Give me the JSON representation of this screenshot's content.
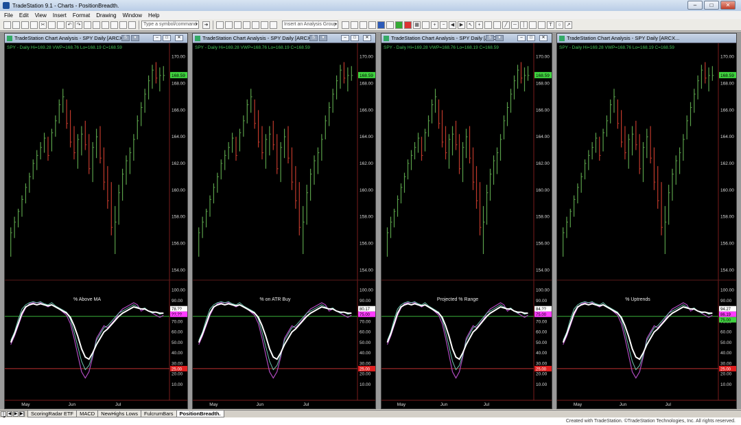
{
  "window": {
    "title": "TradeStation 9.1 - Charts - PositionBreadth."
  },
  "menu": [
    "File",
    "Edit",
    "View",
    "Insert",
    "Format",
    "Drawing",
    "Window",
    "Help"
  ],
  "toolbar": {
    "symbol_placeholder": "Type a symbol/command",
    "analysis_placeholder": "Insert an Analysis Group"
  },
  "charts": [
    {
      "title": "TradeStation Chart Analysis - SPY Daily [ARCX...",
      "quote": "SPY - Daily  Hi=169.28  VWP=168.76  Lo=168.19  C=168.59",
      "indicator": "% Above MA",
      "last_label": "168.59",
      "ind_labels": [
        "78.??",
        "??.??"
      ],
      "lower_label": "25.00"
    },
    {
      "title": "TradeStation Chart Analysis - SPY Daily [ARCX...",
      "quote": "SPY - Daily  Hi=169.28  VWP=168.76  Lo=168.19  C=168.59",
      "indicator": "% on ATR Buy",
      "last_label": "168.59",
      "ind_labels": [
        "80.17",
        "75.00"
      ],
      "lower_label": "25.00"
    },
    {
      "title": "TradeStation Chart Analysis - SPY Daily [ARCX...",
      "quote": "SPY - Daily  Hi=169.28  VWP=168.76  Lo=168.19  C=168.59",
      "indicator": "Projected % Range",
      "last_label": "168.59",
      "ind_labels": [
        "84.??",
        "75.00"
      ],
      "lower_label": "25.00"
    },
    {
      "title": "TradeStation Chart Analysis - SPY Daily [ARCX...",
      "quote": "SPY - Daily  Hi=169.28  VWP=168.76  Lo=168.19  C=168.59",
      "indicator": "% Uptrends",
      "last_label": "168.59",
      "ind_labels": [
        "94.27",
        "86.19",
        "75.00"
      ],
      "lower_label": "25.00"
    }
  ],
  "price_ticks": [
    "170.00",
    "168.00",
    "166.00",
    "164.00",
    "162.00",
    "160.00",
    "158.00",
    "156.00",
    "154.00"
  ],
  "ind_ticks": [
    "100.00",
    "90.00",
    "80.00",
    "70.00",
    "60.00",
    "50.00",
    "40.00",
    "30.00",
    "20.00",
    "10.00"
  ],
  "months": [
    "May",
    "Jun",
    "Jul"
  ],
  "tabs": [
    "ScoringRadar ETF",
    "MACD",
    "NewHighs Lows",
    "FulcrumBars",
    "PositionBreadth."
  ],
  "footer": "Created with TradeStation. ©TradeStation Technologies, Inc. All rights reserved.",
  "colors": {
    "up": "#5aa04a",
    "down": "#c0392b",
    "white": "#ffffff",
    "teal": "#6fc6b0",
    "magenta": "#b04ac0",
    "ma": "#3ab03a",
    "lowline": "#c03030"
  },
  "chart_data": {
    "type": "line",
    "ylabel": "",
    "ylim": [
      153.5,
      170.5
    ],
    "bars": [
      {
        "h": 157.2,
        "l": 155.0,
        "c": 156.8
      },
      {
        "h": 158.0,
        "l": 156.4,
        "c": 157.6
      },
      {
        "h": 158.6,
        "l": 157.2,
        "c": 158.4
      },
      {
        "h": 159.6,
        "l": 158.0,
        "c": 159.3
      },
      {
        "h": 160.5,
        "l": 159.0,
        "c": 160.2
      },
      {
        "h": 161.3,
        "l": 159.8,
        "c": 161.0
      },
      {
        "h": 162.3,
        "l": 160.8,
        "c": 162.0
      },
      {
        "h": 163.0,
        "l": 161.5,
        "c": 162.6
      },
      {
        "h": 163.6,
        "l": 162.3,
        "c": 163.2
      },
      {
        "h": 164.3,
        "l": 162.8,
        "c": 163.9
      },
      {
        "h": 164.0,
        "l": 162.2,
        "c": 162.6
      },
      {
        "h": 164.6,
        "l": 162.9,
        "c": 164.3
      },
      {
        "h": 165.6,
        "l": 164.0,
        "c": 165.2
      },
      {
        "h": 166.8,
        "l": 165.0,
        "c": 166.4
      },
      {
        "h": 167.6,
        "l": 165.8,
        "c": 167.0
      },
      {
        "h": 166.8,
        "l": 164.6,
        "c": 165.0
      },
      {
        "h": 166.0,
        "l": 163.2,
        "c": 163.6
      },
      {
        "h": 164.8,
        "l": 162.3,
        "c": 162.8
      },
      {
        "h": 164.2,
        "l": 161.6,
        "c": 163.8
      },
      {
        "h": 164.8,
        "l": 162.6,
        "c": 164.2
      },
      {
        "h": 165.2,
        "l": 163.0,
        "c": 163.4
      },
      {
        "h": 164.2,
        "l": 161.2,
        "c": 161.6
      },
      {
        "h": 163.6,
        "l": 160.6,
        "c": 163.2
      },
      {
        "h": 164.6,
        "l": 162.4,
        "c": 164.0
      },
      {
        "h": 164.8,
        "l": 162.0,
        "c": 162.4
      },
      {
        "h": 163.2,
        "l": 160.0,
        "c": 160.6
      },
      {
        "h": 161.8,
        "l": 158.6,
        "c": 159.2
      },
      {
        "h": 160.6,
        "l": 156.6,
        "c": 157.2
      },
      {
        "h": 158.8,
        "l": 155.2,
        "c": 157.6
      },
      {
        "h": 160.4,
        "l": 157.4,
        "c": 159.8
      },
      {
        "h": 161.6,
        "l": 159.2,
        "c": 161.2
      },
      {
        "h": 162.6,
        "l": 160.4,
        "c": 162.2
      },
      {
        "h": 163.2,
        "l": 161.2,
        "c": 162.8
      },
      {
        "h": 164.2,
        "l": 162.2,
        "c": 163.8
      },
      {
        "h": 165.6,
        "l": 163.8,
        "c": 165.2
      },
      {
        "h": 166.6,
        "l": 164.8,
        "c": 166.2
      },
      {
        "h": 167.6,
        "l": 165.8,
        "c": 167.2
      },
      {
        "h": 168.6,
        "l": 166.8,
        "c": 168.2
      },
      {
        "h": 169.4,
        "l": 167.6,
        "c": 169.0
      },
      {
        "h": 169.6,
        "l": 168.0,
        "c": 168.4
      },
      {
        "h": 169.2,
        "l": 167.4,
        "c": 168.6
      },
      {
        "h": 169.3,
        "l": 168.2,
        "c": 168.6
      }
    ],
    "series": [
      {
        "values": [
          52,
          60,
          72,
          82,
          86,
          88,
          89,
          88,
          89,
          87,
          86,
          88,
          85,
          83,
          81,
          79,
          72,
          60,
          46,
          32,
          24,
          28,
          38,
          52,
          58,
          64,
          66,
          70,
          74,
          78,
          80,
          82,
          84,
          86,
          84,
          82,
          83,
          80,
          78,
          79,
          77,
          78
        ]
      },
      {
        "values": [
          50,
          58,
          68,
          78,
          84,
          86,
          87,
          86,
          87,
          86,
          85,
          86,
          84,
          82,
          80,
          78,
          74,
          66,
          56,
          44,
          36,
          34,
          40,
          48,
          54,
          60,
          63,
          67,
          71,
          75,
          78,
          80,
          82,
          84,
          83,
          82,
          82,
          80,
          79,
          79,
          78,
          78
        ]
      },
      {
        "values": [
          48,
          56,
          66,
          76,
          83,
          87,
          88,
          88,
          88,
          86,
          84,
          86,
          84,
          82,
          79,
          76,
          68,
          54,
          38,
          22,
          16,
          22,
          36,
          54,
          60,
          66,
          64,
          68,
          72,
          78,
          82,
          84,
          86,
          88,
          86,
          80,
          82,
          80,
          78,
          76,
          74,
          76
        ]
      }
    ],
    "ind_ylim": [
      0,
      105
    ],
    "ma_level": 75,
    "low_level": 25
  }
}
